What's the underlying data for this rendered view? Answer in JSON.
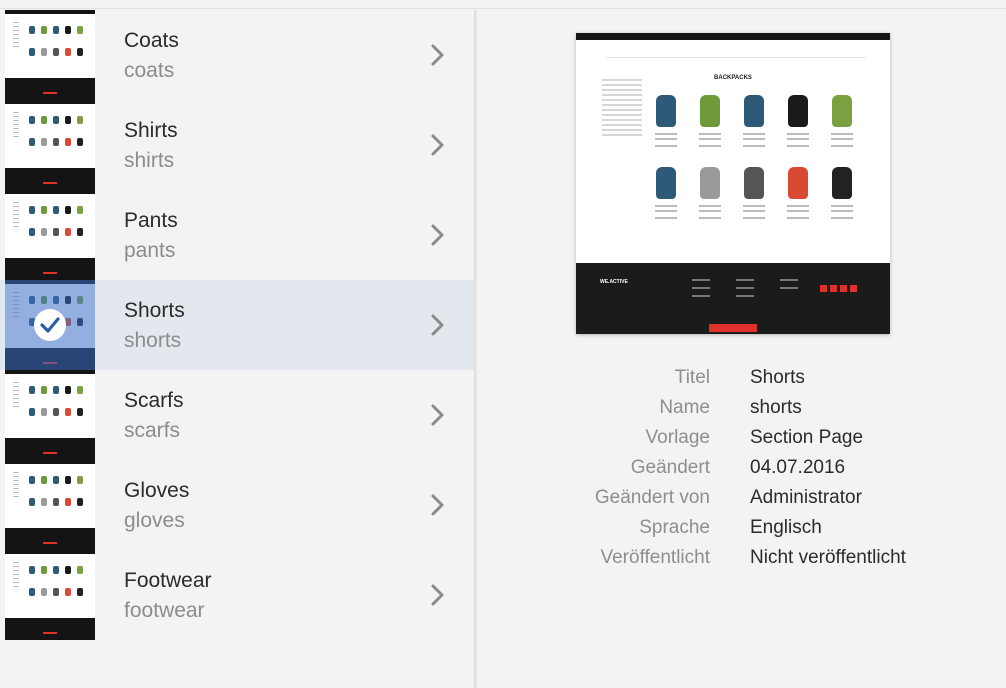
{
  "list": {
    "items": [
      {
        "title": "Coats",
        "name": "coats",
        "selected": false
      },
      {
        "title": "Shirts",
        "name": "shirts",
        "selected": false
      },
      {
        "title": "Pants",
        "name": "pants",
        "selected": false
      },
      {
        "title": "Shorts",
        "name": "shorts",
        "selected": true
      },
      {
        "title": "Scarfs",
        "name": "scarfs",
        "selected": false
      },
      {
        "title": "Gloves",
        "name": "gloves",
        "selected": false
      },
      {
        "title": "Footwear",
        "name": "footwear",
        "selected": false
      }
    ],
    "chevron_icon": "chevron-right-icon",
    "check_icon": "checkmark-icon"
  },
  "preview": {
    "heading": "BACKPACKS",
    "brand": "WE.ACTIVE"
  },
  "properties": [
    {
      "label": "Titel",
      "value": "Shorts"
    },
    {
      "label": "Name",
      "value": "shorts"
    },
    {
      "label": "Vorlage",
      "value": "Section Page"
    },
    {
      "label": "Geändert",
      "value": "04.07.2016"
    },
    {
      "label": "Geändert von",
      "value": "Administrator"
    },
    {
      "label": "Sprache",
      "value": "Englisch"
    },
    {
      "label": "Veröffentlicht",
      "value": "Nicht veröffentlicht"
    }
  ],
  "colors": {
    "selected_row": "#e3e8ef",
    "selection_overlay": "#3b6ec4",
    "accent_red": "#e0312b"
  }
}
